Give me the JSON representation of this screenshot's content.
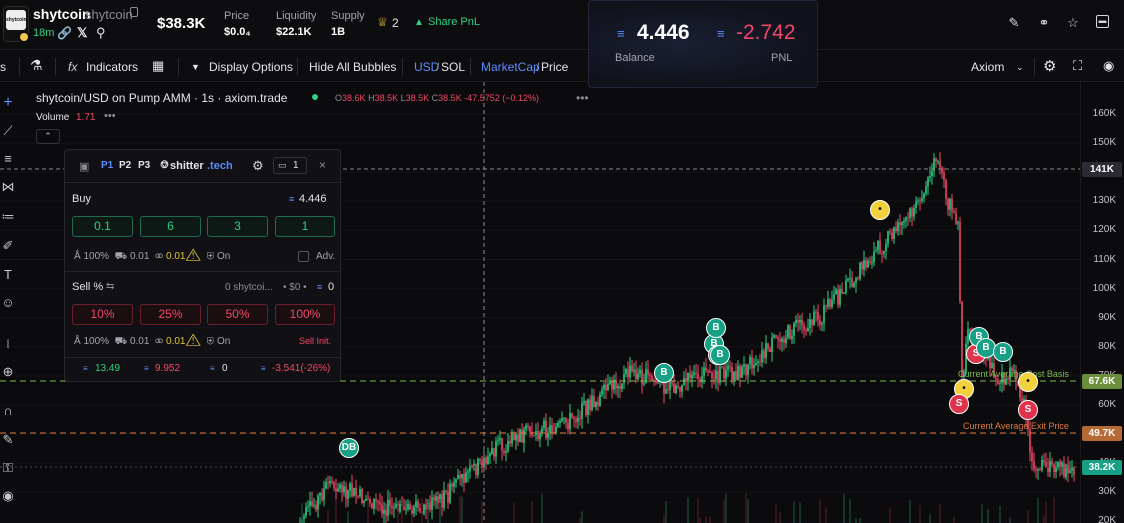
{
  "token": {
    "name": "shytcoin",
    "ticker": "shytcoin",
    "logo_text": "shytcoin",
    "age": "18m",
    "market_cap": "$38.3K",
    "price_label": "Price",
    "price_value": "$0.0₄",
    "price_subscript": "4",
    "liquidity_label": "Liquidity",
    "liquidity_value": "$22.1K",
    "supply_label": "Supply",
    "supply_value": "1B",
    "holders_count": "2",
    "share_pnl": "Share PnL"
  },
  "pnl_card": {
    "balance_value": "4.446",
    "balance_label": "Balance",
    "pnl_value": "-2.742",
    "pnl_label": "PNL"
  },
  "toolbar": {
    "indicators": "Indicators",
    "display_options": "Display Options",
    "hide_bubbles": "Hide All Bubbles",
    "usd": "USD",
    "sol": "SOL",
    "marketcap": "MarketCap",
    "price": "Price",
    "provider": "Axiom"
  },
  "chart": {
    "title": "shytcoin/USD on Pump AMM · 1s · axiom.trade",
    "ohlc": {
      "o_label": "O",
      "o": "38.6K",
      "h_label": "H",
      "h": "38.5K",
      "l_label": "L",
      "l": "38.5K",
      "c_label": "C",
      "c": "38.5K",
      "change": "-47.5752 (−0.12%)"
    },
    "volume_label": "Volume",
    "volume_value": "1.71",
    "price_ticks": [
      "160K",
      "150K",
      "140K",
      "130K",
      "120K",
      "110K",
      "100K",
      "90K",
      "80K",
      "70K",
      "60K",
      "50K",
      "40K",
      "30K",
      "20K"
    ],
    "crosshair_tag": "141K",
    "avg_cost_tag": "67.6K",
    "avg_exit_tag": "49.7K",
    "current_tag": "38.2K",
    "avg_cost_label": "Current Average Cost Basis",
    "avg_exit_label": "Current Average Exit Price",
    "colors": {
      "up": "#2ed183",
      "down": "#f04868",
      "cost_line": "#7bbf4b",
      "exit_line": "#e07b3b"
    }
  },
  "panel": {
    "tabs": [
      "P1",
      "P2",
      "P3"
    ],
    "brand": "shitter",
    "brand_suffix": ".tech",
    "wallet_count": "1",
    "buy_label": "Buy",
    "buy_balance": "4.446",
    "buy_amounts": [
      "0.1",
      "6",
      "3",
      "1"
    ],
    "buy_slippage": "100%",
    "buy_priority": "0.01",
    "buy_tip": "0.01",
    "buy_mev": "On",
    "adv_label": "Adv.",
    "sell_label": "Sell %",
    "sell_holding": "0 shytcoi...",
    "sell_value": "• $0 •",
    "sell_sol": "0",
    "sell_amounts": [
      "10%",
      "25%",
      "50%",
      "100%"
    ],
    "sell_slippage": "100%",
    "sell_priority": "0.01",
    "sell_tip": "0.01",
    "sell_mev": "On",
    "sell_init": "Sell Init.",
    "stats": {
      "bought": "13.49",
      "sold": "9.952",
      "holding": "0",
      "pnl": "-3.541(-26%)"
    }
  },
  "bubbles": {
    "b": "B",
    "s": "S",
    "db": "DB"
  }
}
